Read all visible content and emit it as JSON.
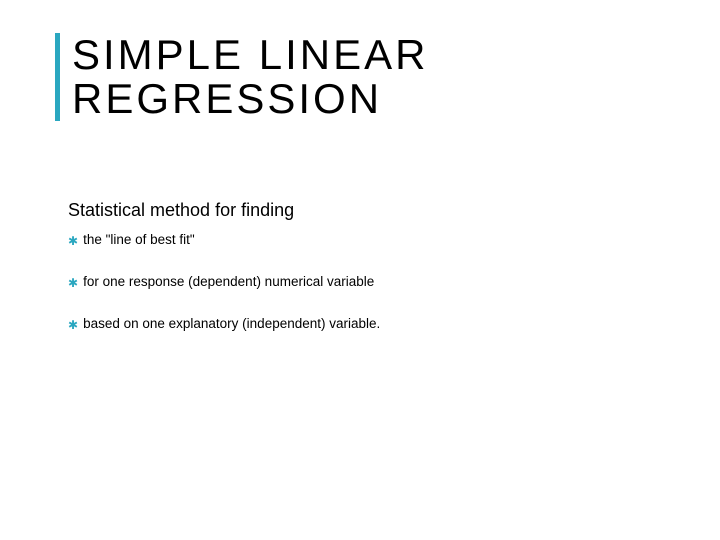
{
  "title": {
    "line1": "SIMPLE LINEAR",
    "line2": "REGRESSION"
  },
  "subtitle": "Statistical method for finding",
  "bullets": [
    {
      "text": "the \"line of best fit\""
    },
    {
      "text": "for one response (dependent) numerical variable"
    },
    {
      "text": "based on one explanatory (independent) variable."
    }
  ],
  "accent_color": "#2aa7c0"
}
